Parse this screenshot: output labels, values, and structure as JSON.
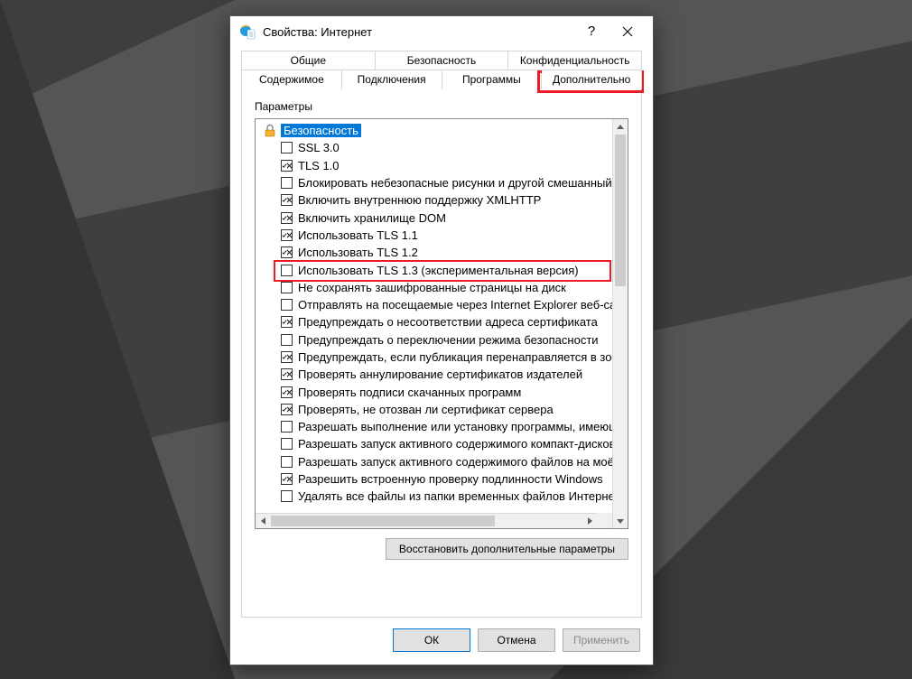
{
  "titlebar": {
    "title": "Свойства: Интернет"
  },
  "tabs": {
    "row1": [
      "Общие",
      "Безопасность",
      "Конфиденциальность"
    ],
    "row2": [
      "Содержимое",
      "Подключения",
      "Программы",
      "Дополнительно"
    ]
  },
  "groupbox_label": "Параметры",
  "security_section_label": "Безопасность",
  "items": [
    {
      "label": "SSL 3.0",
      "checked": false
    },
    {
      "label": "TLS 1.0",
      "checked": true
    },
    {
      "label": "Блокировать небезопасные рисунки и другой смешанный контент",
      "checked": false
    },
    {
      "label": "Включить внутреннюю поддержку XMLHTTP",
      "checked": true
    },
    {
      "label": "Включить хранилище DOM",
      "checked": true
    },
    {
      "label": "Использовать TLS 1.1",
      "checked": true
    },
    {
      "label": "Использовать TLS 1.2",
      "checked": true
    },
    {
      "label": "Использовать TLS 1.3 (экспериментальная версия)",
      "checked": false,
      "highlight": true
    },
    {
      "label": "Не сохранять зашифрованные страницы на диск",
      "checked": false
    },
    {
      "label": "Отправлять на посещаемые через Internet Explorer веб-сайты запросы \"Не отслеживать\"",
      "checked": false
    },
    {
      "label": "Предупреждать о несоответствии адреса сертификата",
      "checked": true
    },
    {
      "label": "Предупреждать о переключении режима безопасности",
      "checked": false
    },
    {
      "label": "Предупреждать, если публикация перенаправляется в зону",
      "checked": true
    },
    {
      "label": "Проверять аннулирование сертификатов издателей",
      "checked": true
    },
    {
      "label": "Проверять подписи скачанных программ",
      "checked": true
    },
    {
      "label": "Проверять, не отозван ли сертификат сервера",
      "checked": true
    },
    {
      "label": "Разрешать выполнение или установку программы, имеющей недопустимую подпись",
      "checked": false
    },
    {
      "label": "Разрешать запуск активного содержимого компакт-дисков",
      "checked": false
    },
    {
      "label": "Разрешать запуск активного содержимого файлов на моём компьютере",
      "checked": false
    },
    {
      "label": "Разрешить встроенную проверку подлинности Windows",
      "checked": true
    },
    {
      "label": "Удалять все файлы из папки временных файлов Интернета",
      "checked": false
    }
  ],
  "restore_btn": "Восстановить дополнительные параметры",
  "buttons": {
    "ok": "ОК",
    "cancel": "Отмена",
    "apply": "Применить"
  }
}
